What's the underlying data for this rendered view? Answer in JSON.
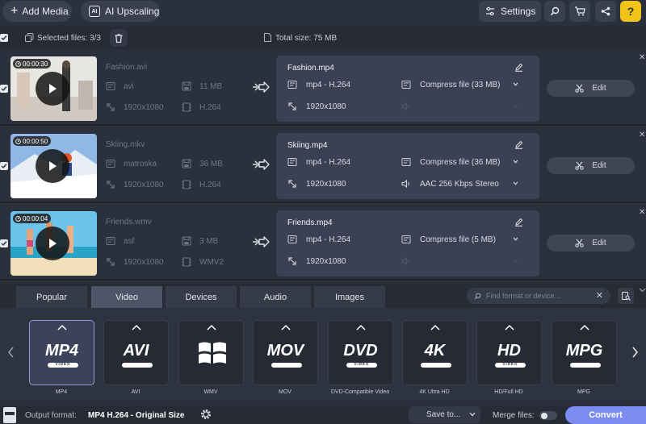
{
  "toolbar": {
    "add_media": "Add Media",
    "ai_upscaling": "AI Upscaling",
    "settings": "Settings",
    "icons": [
      "search-icon",
      "cart-icon",
      "share-icon",
      "help-icon"
    ],
    "help": "?"
  },
  "selection": {
    "selected": "Selected files: 3/3",
    "total": "Total size: 75 MB"
  },
  "files": [
    {
      "duration": "00:00:30",
      "name": "Fashion.avi",
      "container": "avi",
      "size": "11 MB",
      "resolution": "1920x1080",
      "codec": "H.264",
      "output": {
        "name": "Fashion.mp4",
        "format": "mp4 - H.264",
        "compress": "Compress file (33 MB)",
        "resolution": "1920x1080",
        "audio": "",
        "audio_active": false
      },
      "edit": "Edit"
    },
    {
      "duration": "00:00:50",
      "name": "Skiing.mkv",
      "container": "matroska",
      "size": "36 MB",
      "resolution": "1920x1080",
      "codec": "H.264",
      "output": {
        "name": "Skiing.mp4",
        "format": "mp4 - H.264",
        "compress": "Compress file (36 MB)",
        "resolution": "1920x1080",
        "audio": "AAC 256 Kbps Stereo",
        "audio_active": true
      },
      "edit": "Edit"
    },
    {
      "duration": "00:00:04",
      "name": "Friends.wmv",
      "container": "asf",
      "size": "3 MB",
      "resolution": "1920x1080",
      "codec": "WMV2",
      "output": {
        "name": "Friends.mp4",
        "format": "mp4 - H.264",
        "compress": "Compress file (5 MB)",
        "resolution": "1920x1080",
        "audio": "",
        "audio_active": false
      },
      "edit": "Edit"
    }
  ],
  "tabs": [
    "Popular",
    "Video",
    "Devices",
    "Audio",
    "Images"
  ],
  "active_tab": "Video",
  "search": {
    "placeholder": "Find format or device..."
  },
  "formats": [
    {
      "logo": "MP4",
      "sub": "VIDEO",
      "label": "MP4",
      "selected": true
    },
    {
      "logo": "AVI",
      "sub": "",
      "label": "AVI",
      "selected": false
    },
    {
      "logo": "",
      "sub": "",
      "label": "WMV",
      "selected": false
    },
    {
      "logo": "MOV",
      "sub": "",
      "label": "MOV",
      "selected": false
    },
    {
      "logo": "DVD",
      "sub": "VIDEO",
      "label": "DVD-Compatible Video",
      "selected": false
    },
    {
      "logo": "4K",
      "sub": "",
      "label": "4K Ultra HD",
      "selected": false
    },
    {
      "logo": "HD",
      "sub": "VIDEO",
      "label": "HD/Full HD",
      "selected": false
    },
    {
      "logo": "MPG",
      "sub": "",
      "label": "MPG",
      "selected": false
    }
  ],
  "bottom": {
    "output_label": "Output format:",
    "output_value": "MP4 H.264 - Original Size",
    "save_to": "Save to...",
    "merge": "Merge files:",
    "convert": "Convert"
  },
  "colors": {
    "accent": "#7b8cf0",
    "selected_tile_border": "#8d9ad8"
  }
}
